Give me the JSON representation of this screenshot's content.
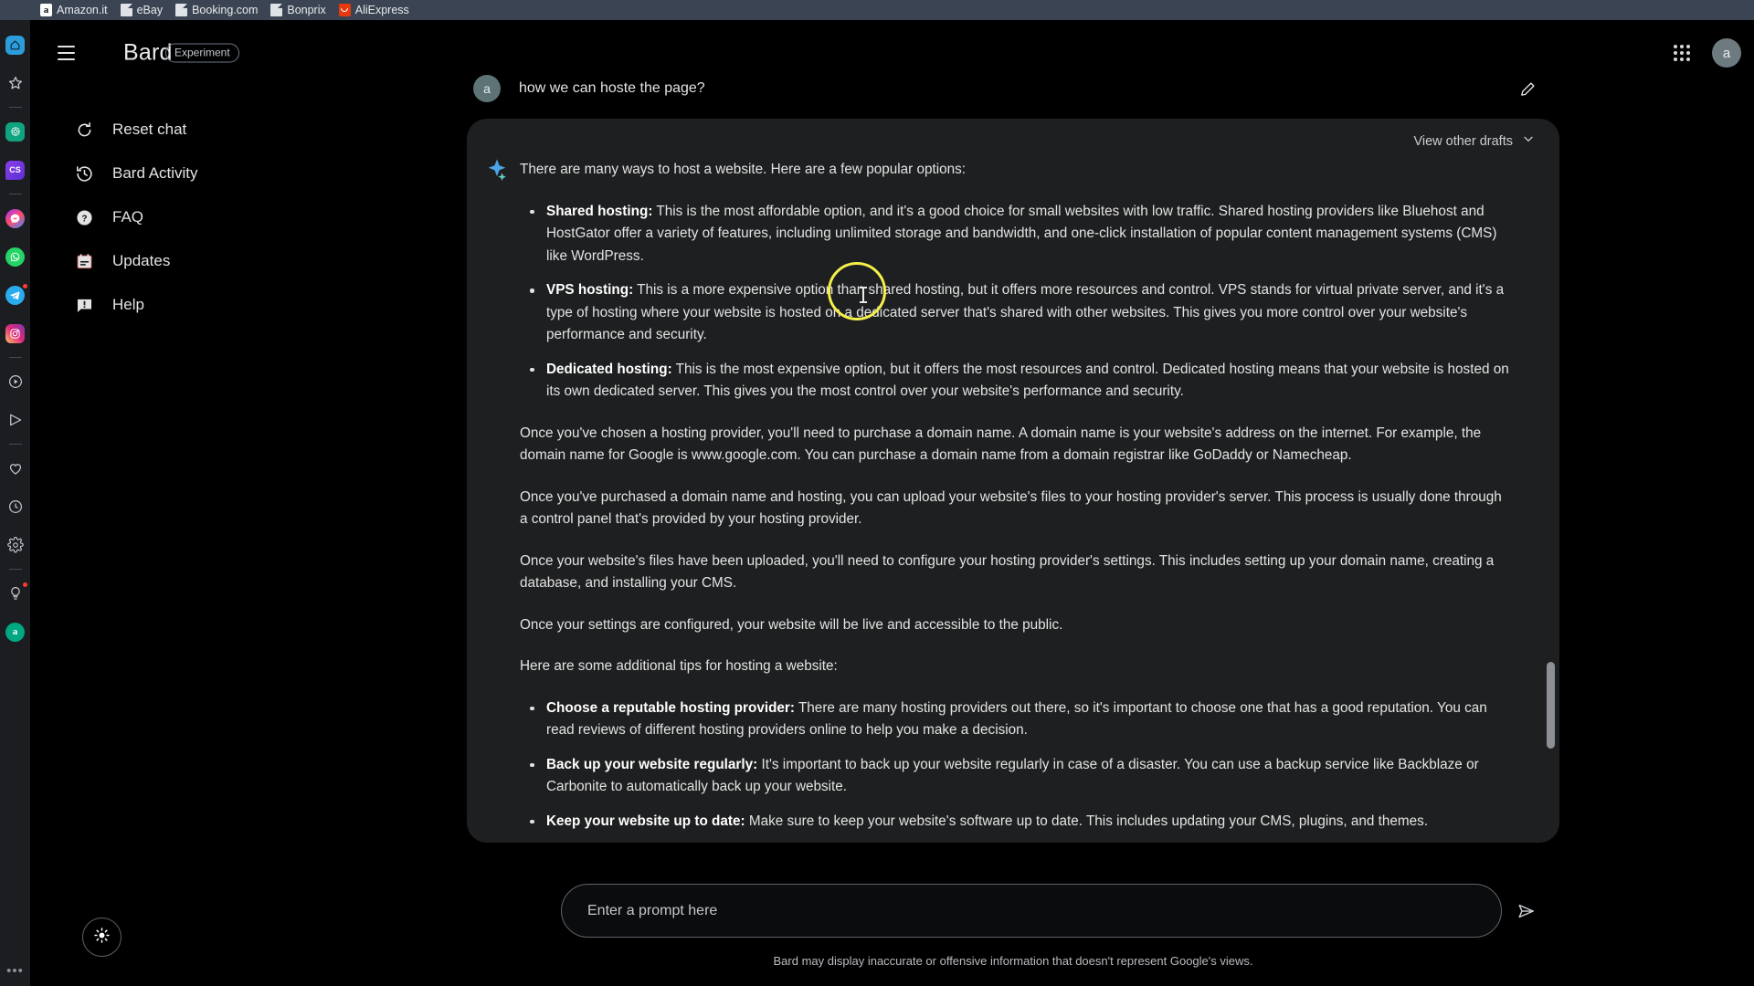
{
  "browser": {
    "bookmarks": [
      {
        "label": "Amazon.it",
        "icon": "amazon-icon"
      },
      {
        "label": "eBay",
        "icon": "document-icon"
      },
      {
        "label": "Booking.com",
        "icon": "document-icon"
      },
      {
        "label": "Bonprix",
        "icon": "document-icon"
      },
      {
        "label": "AliExpress",
        "icon": "aliexpress-icon"
      }
    ]
  },
  "app_rail": {
    "items": [
      {
        "name": "home-icon",
        "color": "#2d9cdb"
      },
      {
        "name": "star-icon",
        "color": "#c9ccd1"
      },
      {
        "name": "chatgpt-icon",
        "color": "#10a37f"
      },
      {
        "name": "cs-icon",
        "color": "#8b3ee8",
        "label": "CS"
      },
      {
        "name": "messenger-icon",
        "color": "#a334fa"
      },
      {
        "name": "whatsapp-icon",
        "color": "#25d366"
      },
      {
        "name": "telegram-icon",
        "color": "#2aabee",
        "badge": true
      },
      {
        "name": "instagram-icon",
        "color": "#dd2a7b"
      },
      {
        "name": "play-circle-icon",
        "color": "#c9ccd1"
      },
      {
        "name": "send-icon",
        "color": "#c9ccd1"
      },
      {
        "name": "heart-icon",
        "color": "#c9ccd1"
      },
      {
        "name": "clock-icon",
        "color": "#c9ccd1"
      },
      {
        "name": "gear-icon",
        "color": "#c9ccd1"
      },
      {
        "name": "lightbulb-icon",
        "color": "#c9ccd1",
        "badge": true
      },
      {
        "name": "avatar-a-icon",
        "color": "#00a882",
        "label": "a"
      }
    ],
    "more_label": "•••"
  },
  "header": {
    "menu_icon": "hamburger-menu-icon",
    "title": "Bard",
    "chip": "Experiment",
    "apps_grid_icon": "apps-grid-icon",
    "avatar_initial": "a"
  },
  "sidebar": {
    "items": [
      {
        "label": "Reset chat",
        "icon": "refresh-icon"
      },
      {
        "label": "Bard Activity",
        "icon": "history-icon"
      },
      {
        "label": "FAQ",
        "icon": "help-circle-icon"
      },
      {
        "label": "Updates",
        "icon": "calendar-icon"
      },
      {
        "label": "Help",
        "icon": "feedback-icon"
      }
    ],
    "theme_toggle_icon": "sun-icon"
  },
  "conversation": {
    "user": {
      "avatar_initial": "a",
      "prompt": "how we can hoste the page?",
      "edit_icon": "pencil-icon"
    },
    "response": {
      "drafts_label": "View other drafts",
      "drafts_chevron_icon": "chevron-down-icon",
      "bard_icon": "bard-sparkle-icon",
      "intro": "There are many ways to host a website. Here are a few popular options:",
      "options": [
        {
          "term": "Shared hosting:",
          "text": " This is the most affordable option, and it's a good choice for small websites with low traffic. Shared hosting providers like Bluehost and HostGator offer a variety of features, including unlimited storage and bandwidth, and one-click installation of popular content management systems (CMS) like WordPress."
        },
        {
          "term": "VPS hosting:",
          "text": " This is a more expensive option than shared hosting, but it offers more resources and control. VPS stands for virtual private server, and it's a type of hosting where your website is hosted on a dedicated server that's shared with other websites. This gives you more control over your website's performance and security."
        },
        {
          "term": "Dedicated hosting:",
          "text": " This is the most expensive option, but it offers the most resources and control. Dedicated hosting means that your website is hosted on its own dedicated server. This gives you the most control over your website's performance and security."
        }
      ],
      "paragraphs": [
        "Once you've chosen a hosting provider, you'll need to purchase a domain name. A domain name is your website's address on the internet. For example, the domain name for Google is www.google.com. You can purchase a domain name from a domain registrar like GoDaddy or Namecheap.",
        "Once you've purchased a domain name and hosting, you can upload your website's files to your hosting provider's server. This process is usually done through a control panel that's provided by your hosting provider.",
        "Once your website's files have been uploaded, you'll need to configure your hosting provider's settings. This includes setting up your domain name, creating a database, and installing your CMS.",
        "Once your settings are configured, your website will be live and accessible to the public."
      ],
      "tips_intro": "Here are some additional tips for hosting a website:",
      "tips": [
        {
          "term": "Choose a reputable hosting provider:",
          "text": " There are many hosting providers out there, so it's important to choose one that has a good reputation. You can read reviews of different hosting providers online to help you make a decision."
        },
        {
          "term": "Back up your website regularly:",
          "text": " It's important to back up your website regularly in case of a disaster. You can use a backup service like Backblaze or Carbonite to automatically back up your website."
        },
        {
          "term": "Keep your website up to date:",
          "text": " Make sure to keep your website's software up to date. This includes updating your CMS, plugins, and themes."
        }
      ]
    }
  },
  "composer": {
    "placeholder": "Enter a prompt here",
    "value": "",
    "send_icon": "send-icon",
    "disclaimer": "Bard may display inaccurate or offensive information that doesn't represent Google's views."
  },
  "colors": {
    "page_bg": "#000000",
    "card_bg": "#1e1f20",
    "rail_bg": "#1b1d21",
    "bookmark_bg": "#3b4452",
    "text": "#e3e3e3",
    "cursor_highlight": "#f4f04a"
  }
}
